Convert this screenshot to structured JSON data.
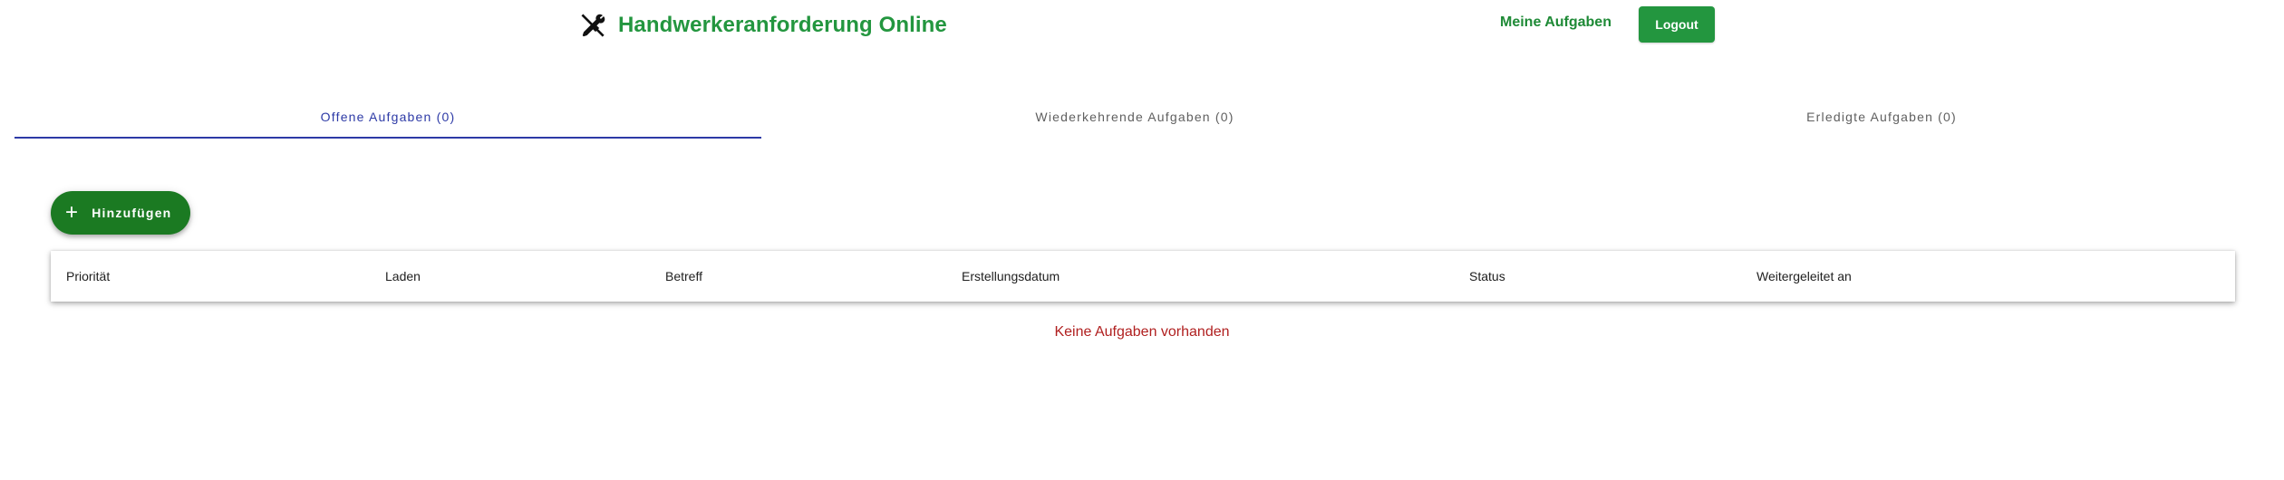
{
  "header": {
    "title": "Handwerkeranforderung Online",
    "icon": "tools-icon",
    "nav_link": "Meine Aufgaben",
    "logout_label": "Logout"
  },
  "tabs": [
    {
      "label": "Offene Aufgaben (0)",
      "active": true
    },
    {
      "label": "Wiederkehrende Aufgaben (0)",
      "active": false
    },
    {
      "label": "Erledigte Aufgaben (0)",
      "active": false
    }
  ],
  "add_button": {
    "label": "Hinzufügen",
    "icon": "plus-icon"
  },
  "table": {
    "columns": [
      "Priorität",
      "Laden",
      "Betreff",
      "Erstellungsdatum",
      "Status",
      "Weitergeleitet an"
    ],
    "empty_message": "Keine Aufgaben vorhanden"
  },
  "colors": {
    "brand_green": "#23963f",
    "add_button_green": "#1b7a22",
    "tab_active": "#2d3aa6",
    "empty_text": "#b01f1f"
  }
}
